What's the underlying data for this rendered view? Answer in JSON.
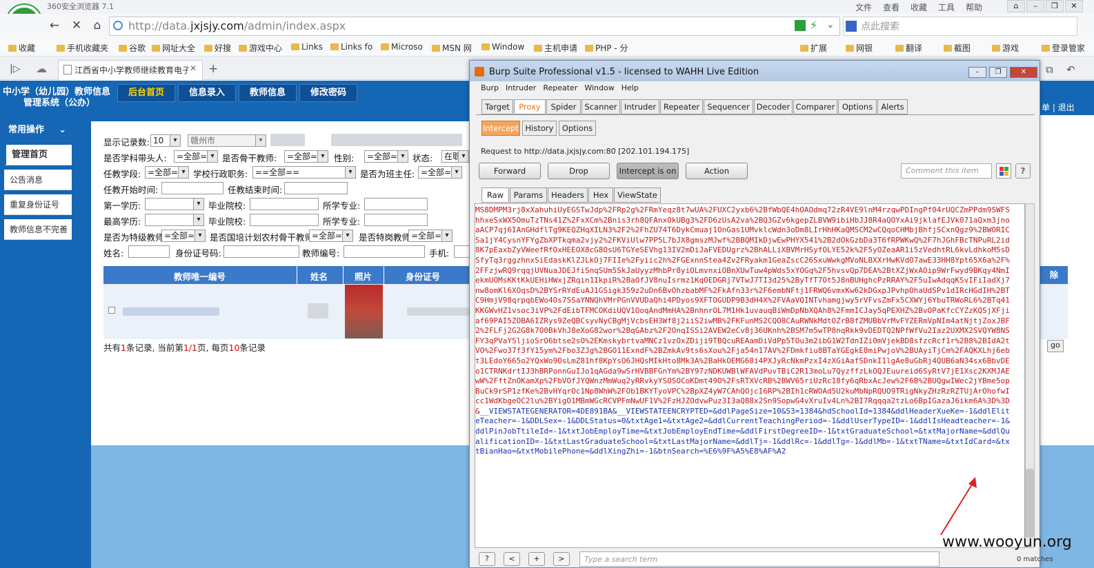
{
  "browser": {
    "app_title": "360安全浏览器 7.1",
    "menu": [
      "文件",
      "查看",
      "收藏",
      "工具",
      "帮助"
    ],
    "url_host": "http://data.",
    "url_domain": "jxjsjy.com",
    "url_path": "/admin/index.aspx",
    "search_placeholder": "点此搜索",
    "bookmarks": [
      "收藏",
      "手机收藏夹",
      "谷歌",
      "网址大全",
      "好搜",
      "游戏中心",
      "Links",
      "Links fo",
      "Microso",
      "MSN 网",
      "Window",
      "主机申请",
      "PHP - 分"
    ],
    "right_tools": [
      "扩展",
      "网银",
      "翻译",
      "截图",
      "游戏",
      "登录管家"
    ],
    "tab_title": "江西省中小学教师继续教育电子"
  },
  "site": {
    "title_line1": "中小学（幼儿园）教师信息",
    "title_line2": "管理系统（公办）",
    "nav": [
      "后台首页",
      "信息录入",
      "教师信息",
      "修改密码"
    ],
    "right_links": "单 | 退出",
    "sidebar_head": "常用操作",
    "sidebar_items": [
      "管理首页",
      "公告消息",
      "重复身份证号",
      "教师信息不完善"
    ]
  },
  "filters": {
    "show_count_label": "显示记录数:",
    "show_count": "10",
    "city": "赣州市",
    "subject_leader_label": "是否学科带头人:",
    "subject_leader": "=全部=",
    "backbone_label": "是否骨干教师:",
    "backbone": "=全部=",
    "gender_label": "性别:",
    "gender": "=全部=",
    "status_label": "状态:",
    "status": "在职",
    "school_stage_label": "任教学段:",
    "school_stage": "=全部=",
    "admin_post_label": "学校行政职务:",
    "admin_post": "==全部==",
    "head_teacher_label": "是否为班主任:",
    "head_teacher": "=全部=",
    "start_time_label": "任教开始时间:",
    "end_time_label": "任教结束时间:",
    "first_degree_label": "第一学历:",
    "grad_school_label": "毕业院校:",
    "major_label": "所学专业:",
    "top_degree_label": "最高学历:",
    "grad_school2_label": "毕业院校:",
    "major2_label": "所学专业:",
    "special_teacher_label": "是否为特级教师",
    "special_teacher": "=全部=",
    "national_plan_label": "是否国培计划农村骨干教师",
    "national_plan": "=全部=",
    "post_teacher_label": "是否特岗教师",
    "post_teacher": "=全部=",
    "name_label": "姓名:",
    "idcard_label": "身份证号码:",
    "teacher_no_label": "教师编号:",
    "phone_label": "手机:"
  },
  "table": {
    "headers": [
      "教师唯一编号",
      "姓名",
      "照片",
      "身份证号"
    ],
    "summary_prefix": "共有",
    "summary_count": "1",
    "summary_mid1": "条记录, 当前第",
    "summary_page": "1/1",
    "summary_mid2": "页, 每页",
    "summary_per": "10",
    "summary_suffix": "条记录",
    "go": "go",
    "right_col_header": "除"
  },
  "burp": {
    "title": "Burp Suite Professional v1.5 - licensed to WAHH Live Edition",
    "menu": [
      "Burp",
      "Intruder",
      "Repeater",
      "Window",
      "Help"
    ],
    "tool_tabs": [
      "Target",
      "Proxy",
      "Spider",
      "Scanner",
      "Intruder",
      "Repeater",
      "Sequencer",
      "Decoder",
      "Comparer",
      "Options",
      "Alerts"
    ],
    "proxy_tabs": [
      "Intercept",
      "History",
      "Options"
    ],
    "request_line": "Request to http://data.jxjsjy.com:80  [202.101.194.175]",
    "buttons": [
      "Forward",
      "Drop",
      "Intercept is on",
      "Action"
    ],
    "comment_placeholder": "Comment this item",
    "view_tabs": [
      "Raw",
      "Params",
      "Headers",
      "Hex",
      "ViewState"
    ],
    "raw_body": "MS8DMPM3rj8xXahuhiUyEGSTwJdp%2FRp2g%2FRmYeqz8t7wUA%2FUXC2yxb6%2BfWbQE4hOAOdmq72zR4VE9lnM4rzqwPDIngPf04rUQCZmPPdm9SWFShhxeSxWX5OmuTzTNs41Z%2FxXCm%2Bnis3rh8QFAnxOkUBg3%2FD6zUsA2va%2BQ3GZv6kgepZLBVW9ibiHbJJ8R4aQOYxAi9jklafEJVk071aQxm3jnoaACP7qj6IAnGHdflTg9KEQZHqXILN3%2F2%2FhZU74T6DykCmuaj1OnGas1UMvklcWdn3oDm8LIrHhHKaQMSCM2wCQqoCHMbjBhfjSCxnQgz9%2BWORICSa1jY4CysnYFYgZbXPTkqma2vjy2%2FKViUlw7PP5L7bJX8gmszMJwf%2BBQMIkDjwEwPHYX541%2B2dOkGzbDa3T6fRPWKwQ%2F7hJGhFBcTNPuRL2id8K7pEaxbZyVWeefRfOxHEEOX8cG8OsU6TGYeSEVhg13IV2mDiJaFVEDUgrz%2BhALLiXBVMrHSyfOLYE52k%2F5yOZeaAR1i5zVedhtRL6kvLdhkoM5sDSfyTq3rggzhnxSiEdaskKlZJLkOj7FIIe%2Fyiic2h%2FGExnnStea4Zv2FRyakm1GeaZscC26SxuWwkgMVoNLBXXrHwKVdO7awE33HH8Ypt65X6a%2F%2FFzjwRQ9rqqjUVNuaJDEJfiSnqSUm5SkJaUyyzMhbPr8yiOLmvnxiOBnXUwTuw4pWds5xYOGq%2F5hvsvQp7DEA%2BtXZjWxAOip9WrFwyd9BKqy4NmIekmUOMsKKtKkUEHiHWxjZRqin1IkpiR%2BaOfJV8nuIsrmz1KqOEDGRj7VTwJ7TI3d25%2ByTfT7Ot5J8nBUHghcPzRRAY%2F5uIwAdqqKSvIFiIadXj7nw8omKl6XOqsD%2BYSrRYdEuAJ1GSigk359z2uDn6BvOhzbabMF%2FkAfn33r%2F6embNFtj1FRWQ6vmxKw62kDGxpJPvhpOhaUdSPv1dIRcHGdIH%2BTC9HmjV98qrpqbEWo4Os7SSaYNNQhVMrPGnVVUDaQhi4PDyos9XFTOGUDP9B3dH4X%2FVAaVQINTvhamgjwy5rVFvsZmFx5CXWYj6YbuTRWoRL6%2BTq41KKGWvHZ1vsoc3iVP%2FdEibTFMCOKdiUQV1OoqAndMmHA%2BnhnrOL7M1Hk1uvauqBiWmDpNbXQAh8%2FmmICJay5qPEXHZ%2BvOPaKfcCYZzKQSjXFjiaf69PAI5ZOBA6IZRys9ZeQBCsyvNyCBgMjVcbsEH3Wf8j2iiS2iwMB%2FKFunMS2CQO8CAuRWNkMdtOZrB8fZMUBbVrMvFYZERmVpNIm4atNjtjZoxJBF2%2FLFj2G2G8k7O0BkVhJ8eXoG82wor%2BqGAbz%2F2OnqISSi2AVEW2eCv8j36UKnh%2BSM7m5wTP8nqRkk9vDEDTQ2NPfWfVu2Iaz2UXMX2SVQYW8NSFY3qPVaYSljioSrO6btse2sO%2EKmskybrtvaMNCz1vzOxZDiji9TBQcuREAamDiVdPp5TOu3m2ibG1W2TdnIZi0mVjekBD8sfzcRcf1r%2B8%2BIdA2tVO%2Fwo37f3fY15ym%2Fbo3ZJg%2BGO11ExndF%2BZmkAv9ts6sXou%2Fja54n17AV%2FDmkfiu8BTaYGEgkE8miPwjoV%2BUAyiTjCm%2FAQKXLhj6ebt3LEdoY665o2YQxWo9OsLmZ81hf8KpYsO6JHQsMIkHto8Mk3A%2BaHkOEMG68i4PXJyRcNkmPzxI4zXGiAafSDnkI1lgAe8uGbRj4QUB6aN34sx6BbvDEo1CTRNKdrtIJ3hBRPonnGuIJo1qAGda9wSrHVBBFGnYm%2BY97zNDKUWBlWFAVdPuvTBiC2R13moLu7QyzffzLkOQJEuureid6SyRtV7jE1Xsc2KXMJAEwW%2FftZnOKamXp%2FbVOfJYQWnzMmWuq2yRRvkyYSOSOCoKDmt49O%2FsRTXVcRB%2BWV65riUzRc18fy6qRbxAcJew%2F6B%2BUQgwIWec2jYBme5opBuCk9rSP1zfKe%2BvHYqrOc1Np8WhW%2FOb1BKYTyoVPC%2BpXZ4yW7CAhQOjcI6RP%2BIh1cRWOAd5U2kuMbNpRQUO9TRigNkyZHzRzRZTUjArOhofwIcc1WdKbgeOC2lu%2BYigO1MBmWGcRCVPFmNwUF1V%2FzHJZOdvwPuz3I3aQ88x2Sn9SopwG4vXruIv4Ln%2BI7Rqqqa2tzLo6BpIGazaJ6ikm6A%3D%3D&",
    "raw_tail_key1": "__VIEWSTATEGENERATOR",
    "raw_tail_val1": "=4DE891BA&",
    "raw_tail_key2": "__VIEWSTATEENCRYPTED",
    "raw_tail_val2": "=&ddlPageSize=10&S3=1384&hdSchoolId=1384&ddlHeaderXueKe=-1&ddlEliteTeacher=-1&DDLSex=-1&DDLStatus=0&txtAge1=&txtAge2=&ddlCurrentTeachingPeriod=-1&ddlUserTypeID=-1&ddlIsHeadteacher=-1&ddlPinJobTtileId=-1&txtJobEmployTime=&txtJobEmployEndTime=&ddlFirstDegreeID=-1&txtGraduateSchool=&txtMajorName=&ddlQualificationID=-1&txtLastGraduateSchool=&txtLastMajorName=&ddlTj=-1&ddlRc=-1&ddlTg=-1&ddlMb=-1&txtTName=&txtIdCard=&txtBianHao=&txtMobilePhone=&ddlXingZhi=-1&btnSearch=%E6%9F%A5%E8%AF%A2",
    "nav_buttons": [
      "?",
      "<",
      "+",
      ">"
    ],
    "search_placeholder": "Type a search term",
    "matches": "0 matches"
  },
  "watermark": "www.wooyun.org"
}
